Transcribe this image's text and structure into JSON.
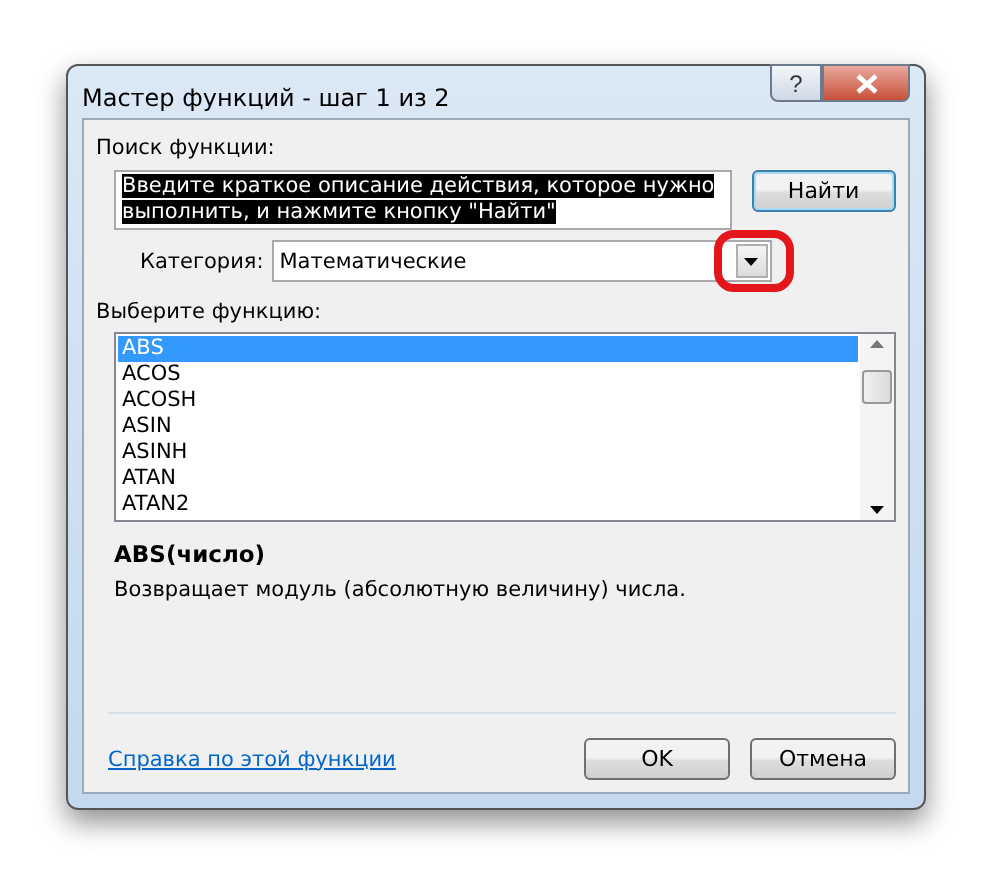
{
  "window": {
    "title": "Мастер функций - шаг 1 из 2",
    "title_buttons": [
      {
        "kind": "help",
        "label": "?"
      },
      {
        "kind": "close"
      }
    ]
  },
  "search": {
    "label": "Поиск функции:",
    "value": "Введите краткое описание действия, которое нужно выполнить, и нажмите кнопку \"Найти\"",
    "text_selected": true,
    "button": "Найти"
  },
  "category": {
    "label": "Категория:",
    "value": "Математические",
    "highlighted": true
  },
  "functions": {
    "label": "Выберите функцию:",
    "items": [
      {
        "name": "ABS",
        "selected": true
      },
      {
        "name": "ACOS",
        "selected": false
      },
      {
        "name": "ACOSH",
        "selected": false
      },
      {
        "name": "ASIN",
        "selected": false
      },
      {
        "name": "ASINH",
        "selected": false
      },
      {
        "name": "ATAN",
        "selected": false
      },
      {
        "name": "ATAN2",
        "selected": false
      }
    ]
  },
  "signature": "ABS(число)",
  "description": "Возвращает модуль (абсолютную величину) числа.",
  "help_link": "Справка по этой функции",
  "buttons": [
    {
      "label": "OK",
      "default": false
    },
    {
      "label": "Отмена",
      "default": false
    }
  ]
}
